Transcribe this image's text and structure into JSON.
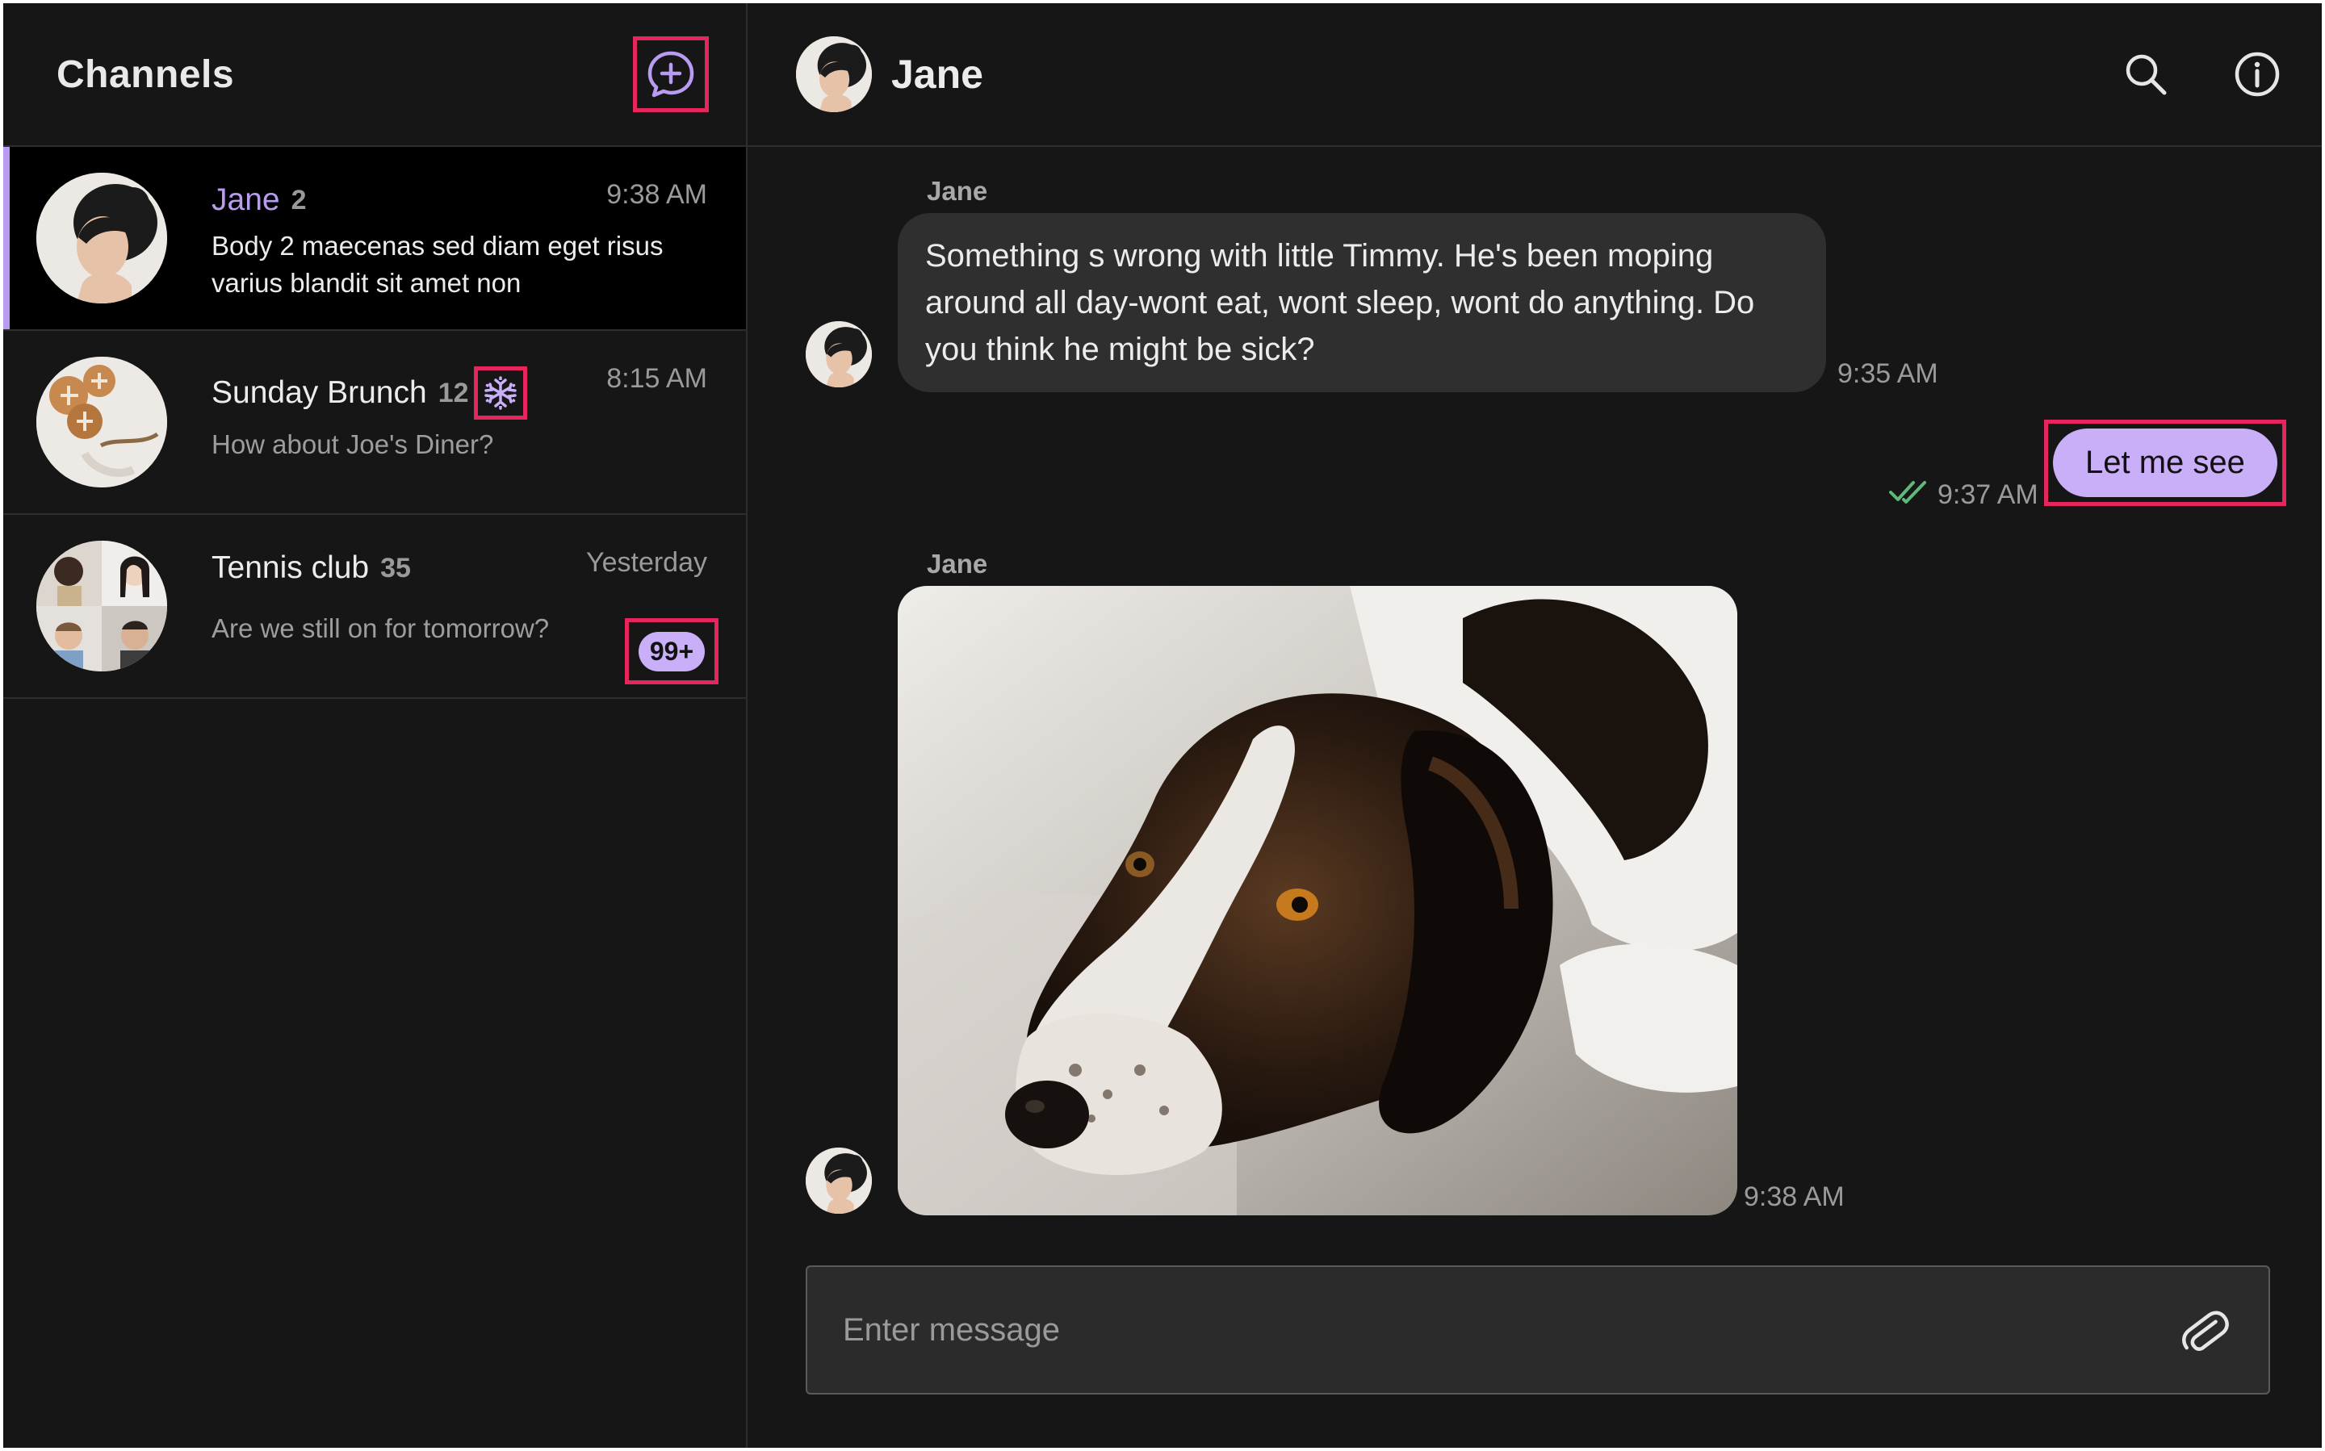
{
  "sidebar": {
    "title": "Channels",
    "channels": [
      {
        "name": "Jane",
        "count": "2",
        "time": "9:38 AM",
        "preview": "Body 2 maecenas sed diam eget risus varius blandit sit amet non",
        "active": true
      },
      {
        "name": "Sunday Brunch",
        "count": "12",
        "time": "8:15 AM",
        "preview": "How about Joe's Diner?",
        "muted_icon": "snowflake-icon"
      },
      {
        "name": "Tennis club",
        "count": "35",
        "time": "Yesterday",
        "preview": "Are we still on for tomorrow?",
        "unread": "99+"
      }
    ]
  },
  "chat": {
    "name": "Jane",
    "messages": [
      {
        "sender": "Jane",
        "text": "Something s wrong with little Timmy. He's been moping around all day-wont eat, wont sleep, wont do anything. Do you think he might be sick?",
        "time": "9:35 AM"
      },
      {
        "outgoing": true,
        "text": "Let me see",
        "time": "9:37 AM",
        "status_icon": "double-check-icon"
      },
      {
        "sender": "Jane",
        "image": "dog-photo",
        "time": "9:38 AM"
      }
    ],
    "composer": {
      "placeholder": "Enter message"
    }
  },
  "colors": {
    "background": "#161616",
    "accent": "#b79cf2",
    "outgoing_bubble": "#c9aef8",
    "incoming_bubble": "#2f2f2f",
    "highlight": "#e8265e",
    "read_check": "#5fb97a"
  }
}
